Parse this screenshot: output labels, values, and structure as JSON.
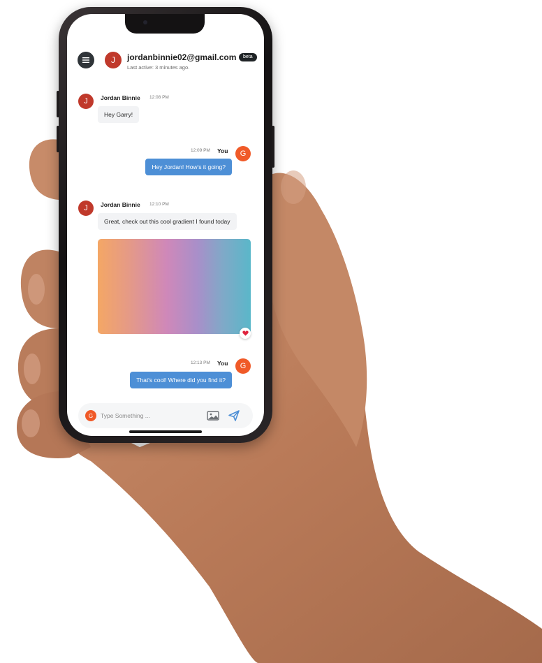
{
  "header": {
    "menu_icon": "hamburger-menu-icon",
    "avatar_initial": "J",
    "email": "jordanbinnie02@gmail.com",
    "status": "Last active: 3 minutes ago.",
    "badge": "beta"
  },
  "colors": {
    "contact_avatar": "#c0392b",
    "self_avatar": "#f05a28",
    "outgoing_bubble": "#4d8fd6",
    "incoming_bubble": "#f2f3f5",
    "heart": "#e0243e"
  },
  "messages": [
    {
      "sender": "Jordan Binnie",
      "initial": "J",
      "time": "12:08 PM",
      "text": "Hey Garry!"
    },
    {
      "sender": "You",
      "initial": "G",
      "time": "12:09 PM",
      "text": "Hey Jordan! How's it going?"
    },
    {
      "sender": "Jordan Binnie",
      "initial": "J",
      "time": "12:10 PM",
      "text": "Great, check out this cool gradient I found today",
      "attachment": "gradient-image",
      "reaction": "heart-icon"
    },
    {
      "sender": "You",
      "initial": "G",
      "time": "12:13 PM",
      "text": "That's cool! Where did you find it?"
    }
  ],
  "composer": {
    "avatar_initial": "G",
    "placeholder": "Type Something ...",
    "value": "",
    "image_icon": "image-icon",
    "send_icon": "send-icon"
  }
}
